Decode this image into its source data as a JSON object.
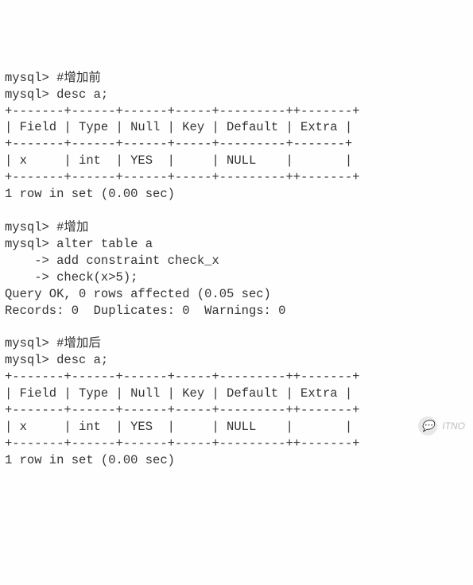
{
  "prompt": "mysql>",
  "cont": "    ->",
  "table1": {
    "borders": {
      "top": "+-------+------+------+-----+---------++-------+",
      "hdrtop": "+-------+------+------+-----+---------+-------+",
      "end": "+-------+------+------+-----+---------++-------+"
    },
    "comment": "#增加前",
    "cmd": "desc a;",
    "header": "| Field | Type | Null | Key | Default | Extra |",
    "row": "| x     | int  | YES  |     | NULL    |       |",
    "footer": "1 row in set (0.00 sec)"
  },
  "section2": {
    "comment": "#增加",
    "cmd1": "alter table a",
    "cmd2": "add constraint check_x",
    "cmd3": "check(x>5);",
    "result1": "Query OK, 0 rows affected (0.05 sec)",
    "result2": "Records: 0  Duplicates: 0  Warnings: 0"
  },
  "table2": {
    "borders": {
      "top": "+-------+------+------+-----+---------++-------+",
      "end": "+-------+------+------+-----+---------++-------+"
    },
    "comment": "#增加后",
    "cmd": "desc a;",
    "header": "| Field | Type | Null | Key | Default | Extra |",
    "row": "| x     | int  | YES  |     | NULL    |       |",
    "footer": "1 row in set (0.00 sec)"
  },
  "watermark": {
    "text": "ITNO",
    "icon": "💬"
  }
}
